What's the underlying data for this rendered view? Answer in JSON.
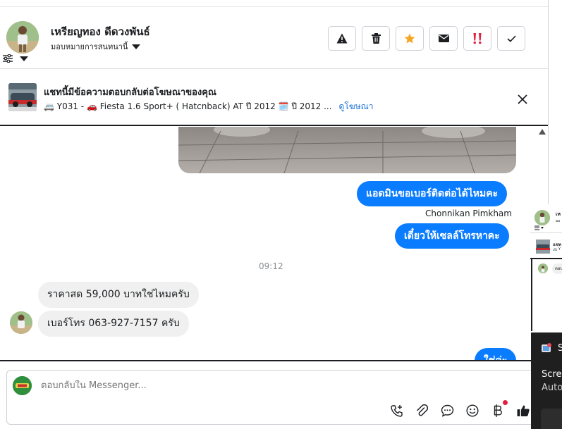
{
  "header": {
    "user_name": "เหรียญทอง ดีดวงพันธ์",
    "assign_label": "มอบหมายการสนทนานี้",
    "buttons": [
      {
        "name": "report-button",
        "icon": "warning-icon"
      },
      {
        "name": "delete-button",
        "icon": "trash-icon"
      },
      {
        "name": "star-button",
        "icon": "star-icon",
        "color": "#f5a623"
      },
      {
        "name": "mark-unread-button",
        "icon": "envelope-icon"
      },
      {
        "name": "spam-button",
        "icon": "double-exclamation-icon",
        "color": "#e41e3f"
      },
      {
        "name": "done-button",
        "icon": "checkmark-icon"
      }
    ]
  },
  "ad_banner": {
    "title": "แชทนี้มีข้อความตอบกลับต่อโฆษณาของคุณ",
    "subtitle": "🚐 Y031 - 🚗 Fiesta 1.6 Sport+ ( Hatcnback) AT ปี 2012 🗓️ ปี 2012 ...",
    "link": "ดูโฆษณา"
  },
  "messages": [
    {
      "direction": "out",
      "text": "แอดมินขอเบอร์ติดต่อได้ไหมคะ"
    },
    {
      "direction": "meta",
      "text": "Chonnikan Pimkham"
    },
    {
      "direction": "out",
      "text": "เดี๋ยวให้เซลล์โทรหาคะ"
    },
    {
      "direction": "time",
      "text": "09:12"
    },
    {
      "direction": "in",
      "text": "ราคาสด 59,000 บาทใช่ไหมครับ"
    },
    {
      "direction": "in",
      "text": "เบอร์โทร 063-927-7157 ครับ"
    },
    {
      "direction": "out",
      "text": "ใช่ค่ะ"
    }
  ],
  "composer": {
    "placeholder": "ตอบกลับใน Messenger...",
    "tools": [
      "add-call-icon",
      "attach-icon",
      "chat-bubble-icon",
      "emoji-icon",
      "baht-icon",
      "thumbs-up-icon"
    ]
  },
  "colors": {
    "accent": "#0a7cff",
    "link": "#1a6fd6",
    "notification_dot": "#e41e3f"
  },
  "toast": {
    "title": "S",
    "text1": "Scree",
    "text2": "Auto"
  },
  "mini_panel": {
    "name_fragment": "เห",
    "sub_fragment": "มอ",
    "ad_fragment": "แชท",
    "ad_sub_fragment": "🚐 Y",
    "message_fragment": "ตอบ"
  }
}
